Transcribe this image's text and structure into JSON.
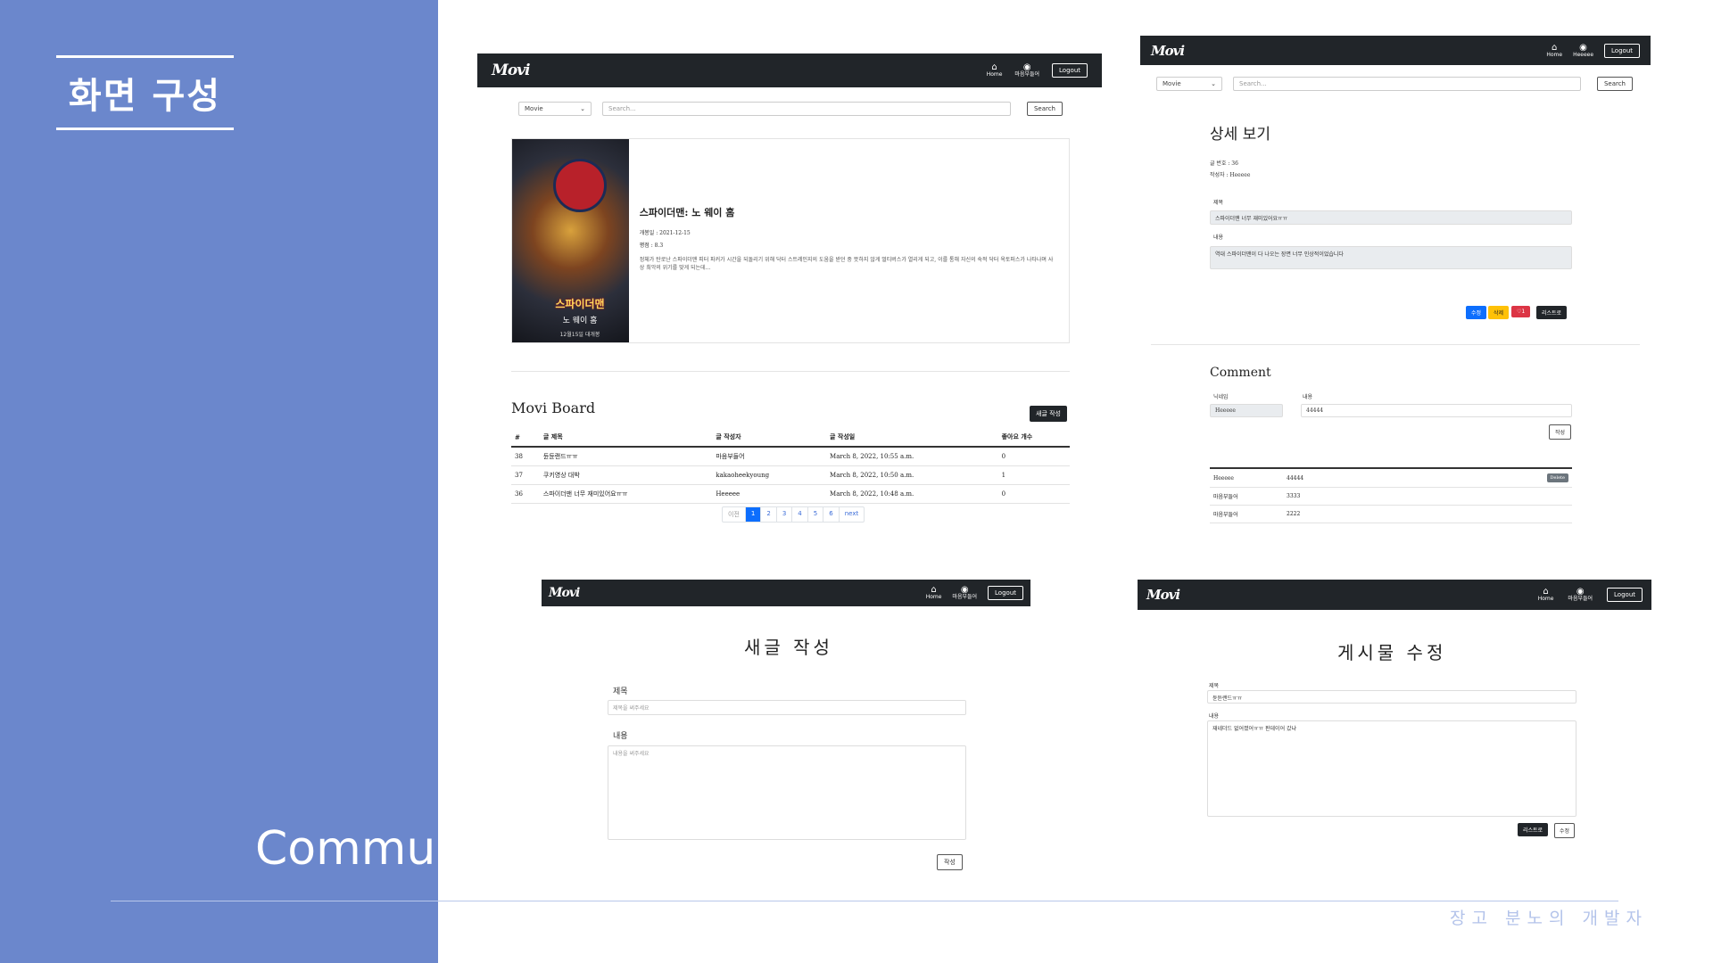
{
  "slide": {
    "title": "화면 구성",
    "side_label": "Commu",
    "footer": "장고 분노의 개발자"
  },
  "app": {
    "logo": "Movi",
    "nav_home": "Home",
    "nav_user": "마음부들어",
    "nav_logout": "Logout"
  },
  "search": {
    "select": "Movie",
    "placeholder": "Search...",
    "button": "Search"
  },
  "main": {
    "movie": {
      "title": "스파이더맨: 노 웨이 홈",
      "release": "개봉일 : 2021-12-15",
      "rating": "평점 : 8.3",
      "desc": "정체가 탄로난 스파이더맨 피터 파커가 시간을 되돌리기 위해 닥터 스트레인지의 도움을 받던 중 뜻하지 않게 멀티버스가 열리게 되고, 이를 통해 자신의 숙적 닥터 옥토퍼스가 나타나며 사상 최악의 위기를 맞게 되는데...",
      "poster_title": "스파이더맨",
      "poster_sub": "노 웨이 홈",
      "poster_date": "12월15일 대개봉"
    },
    "board": {
      "title": "Movi Board",
      "write_button": "새글 작성",
      "columns": [
        "#",
        "글 제목",
        "글 작성자",
        "글 작성일",
        "좋아요 개수"
      ],
      "rows": [
        [
          "38",
          "듄듄랜드ㅠㅠ",
          "마음부들어",
          "March 8, 2022, 10:55 a.m.",
          "0"
        ],
        [
          "37",
          "쿠키영상 대박",
          "kakaoheekyoung",
          "March 8, 2022, 10:50 a.m.",
          "1"
        ],
        [
          "36",
          "스파이더맨 너무 재미있어요ㅠㅠ",
          "Heeeee",
          "March 8, 2022, 10:48 a.m.",
          "0"
        ]
      ],
      "pager": [
        "이전",
        "1",
        "2",
        "3",
        "4",
        "5",
        "6",
        "next"
      ]
    }
  },
  "detail": {
    "title": "상세 보기",
    "post_no": "글 번호 : 36",
    "author": "작성자 : Heeeee",
    "label_title": "제목",
    "value_title": "스파이더맨 너무 재미있어요ㅠㅠ",
    "label_content": "내용",
    "value_content": "역대 스파이더맨이 다 나오는 장면 너무 인상적이었습니다",
    "btn_edit": "수정",
    "btn_delete": "삭제",
    "btn_like": "♡1",
    "btn_list": "리스트로",
    "comment_title": "Comment",
    "label_nick": "닉네임",
    "label_body": "내용",
    "nick_value": "Heeeee",
    "body_value": "44444",
    "btn_write": "작성",
    "comments": [
      {
        "user": "Heeeee",
        "text": "44444",
        "action": "Delete"
      },
      {
        "user": "마음부들어",
        "text": "3333"
      },
      {
        "user": "마음부들어",
        "text": "2222"
      }
    ]
  },
  "write": {
    "title": "새글 작성",
    "label_title": "제목",
    "ph_title": "제목을 써주세요",
    "label_content": "내용",
    "ph_content": "내용을 써주세요",
    "button": "작성"
  },
  "edit": {
    "title": "게시물 수정",
    "label_title": "제목",
    "value_title": "듄듄랜드ㅠㅠ",
    "label_content": "내용",
    "value_content": "재네더드 없어졌어ㅠㅠ 판데이어 갔냐",
    "btn_list": "리스트로",
    "btn_edit": "수정"
  },
  "colors": {
    "panel": "#6b87cc",
    "navbar": "#212529",
    "primary": "#0d6efd",
    "warning": "#ffc107",
    "danger": "#dc3545"
  }
}
